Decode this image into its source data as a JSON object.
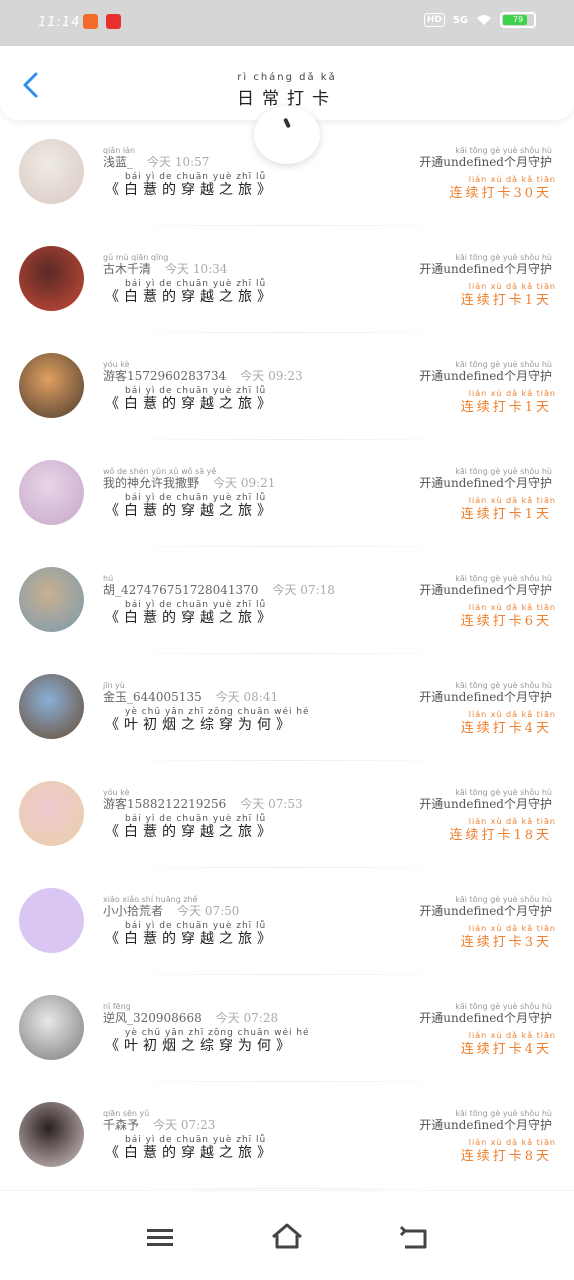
{
  "status_bar": {
    "time": "11:14",
    "network": "5G",
    "hd": "HD",
    "battery": "79"
  },
  "header": {
    "title": "日常打卡",
    "title_pinyin": "rì cháng dǎ kǎ"
  },
  "colors": {
    "accent": "#2f8ef0",
    "streak": "#ef7f2c"
  },
  "rows": [
    {
      "name": "浅蓝_",
      "name_pinyin": "qiǎn lán",
      "time": "今天 10:57",
      "book": "《白薏的穿越之旅》",
      "book_pinyin": "bái yì de chuān yuè zhī lǚ",
      "open": "开通undefined个月守护",
      "open_pinyin": "kāi tōng                    gè yuè shǒu hù",
      "streak": "连续打卡30天",
      "streak_pinyin": "lián xù dǎ kǎ tiān"
    },
    {
      "name": "古木千清",
      "name_pinyin": "gǔ mù qiān qīng",
      "time": "今天 10:34",
      "book": "《白薏的穿越之旅》",
      "book_pinyin": "bái yì de chuān yuè zhī lǚ",
      "open": "开通undefined个月守护",
      "open_pinyin": "kāi tōng                    gè yuè shǒu hù",
      "streak": "连续打卡1天",
      "streak_pinyin": "lián xù dǎ kǎ tiān"
    },
    {
      "name": "游客1572960283734",
      "name_pinyin": "yóu kè",
      "time": "今天 09:23",
      "book": "《白薏的穿越之旅》",
      "book_pinyin": "bái yì de chuān yuè zhī lǚ",
      "open": "开通undefined个月守护",
      "open_pinyin": "kāi tōng                    gè yuè shǒu hù",
      "streak": "连续打卡1天",
      "streak_pinyin": "lián xù dǎ kǎ tiān"
    },
    {
      "name": "我的神允许我撒野",
      "name_pinyin": "wǒ de shén yǔn xǔ wǒ sā yě",
      "time": "今天 09:21",
      "book": "《白薏的穿越之旅》",
      "book_pinyin": "bái yì de chuān yuè zhī lǚ",
      "open": "开通undefined个月守护",
      "open_pinyin": "kāi tōng                    gè yuè shǒu hù",
      "streak": "连续打卡1天",
      "streak_pinyin": "lián xù dǎ kǎ tiān"
    },
    {
      "name": "胡_427476751728041370",
      "name_pinyin": "hú",
      "time": "今天 07:18",
      "book": "《白薏的穿越之旅》",
      "book_pinyin": "bái yì de chuān yuè zhī lǚ",
      "open": "开通undefined个月守护",
      "open_pinyin": "kāi tōng                    gè yuè shǒu hù",
      "streak": "连续打卡6天",
      "streak_pinyin": "lián xù dǎ kǎ tiān"
    },
    {
      "name": "金玉_644005135",
      "name_pinyin": "jīn yù",
      "time": "今天 08:41",
      "book": "《叶初烟之综穿为何》",
      "book_pinyin": "yè chū yān zhī zōng chuān wéi hé",
      "open": "开通undefined个月守护",
      "open_pinyin": "kāi tōng                    gè yuè shǒu hù",
      "streak": "连续打卡4天",
      "streak_pinyin": "lián xù dǎ kǎ tiān"
    },
    {
      "name": "游客1588212219256",
      "name_pinyin": "yóu kè",
      "time": "今天 07:53",
      "book": "《白薏的穿越之旅》",
      "book_pinyin": "bái yì de chuān yuè zhī lǚ",
      "open": "开通undefined个月守护",
      "open_pinyin": "kāi tōng                    gè yuè shǒu hù",
      "streak": "连续打卡18天",
      "streak_pinyin": "lián xù dǎ kǎ tiān"
    },
    {
      "name": "小小拾荒者",
      "name_pinyin": "xiǎo xiǎo shí huāng zhě",
      "time": "今天 07:50",
      "book": "《白薏的穿越之旅》",
      "book_pinyin": "bái yì de chuān yuè zhī lǚ",
      "open": "开通undefined个月守护",
      "open_pinyin": "kāi tōng                    gè yuè shǒu hù",
      "streak": "连续打卡3天",
      "streak_pinyin": "lián xù dǎ kǎ tiān"
    },
    {
      "name": "逆风_320908668",
      "name_pinyin": "nì fēng",
      "time": "今天 07:28",
      "book": "《叶初烟之综穿为何》",
      "book_pinyin": "yè chū yān zhī zōng chuān wéi hé",
      "open": "开通undefined个月守护",
      "open_pinyin": "kāi tōng                    gè yuè shǒu hù",
      "streak": "连续打卡4天",
      "streak_pinyin": "lián xù dǎ kǎ tiān"
    },
    {
      "name": "千森予",
      "name_pinyin": "qiān sēn yǔ",
      "time": "今天 07:23",
      "book": "《白薏的穿越之旅》",
      "book_pinyin": "bái yì de chuān yuè zhī lǚ",
      "open": "开通undefined个月守护",
      "open_pinyin": "kāi tōng                    gè yuè shǒu hù",
      "streak": "连续打卡8天",
      "streak_pinyin": "lián xù dǎ kǎ tiān"
    }
  ]
}
